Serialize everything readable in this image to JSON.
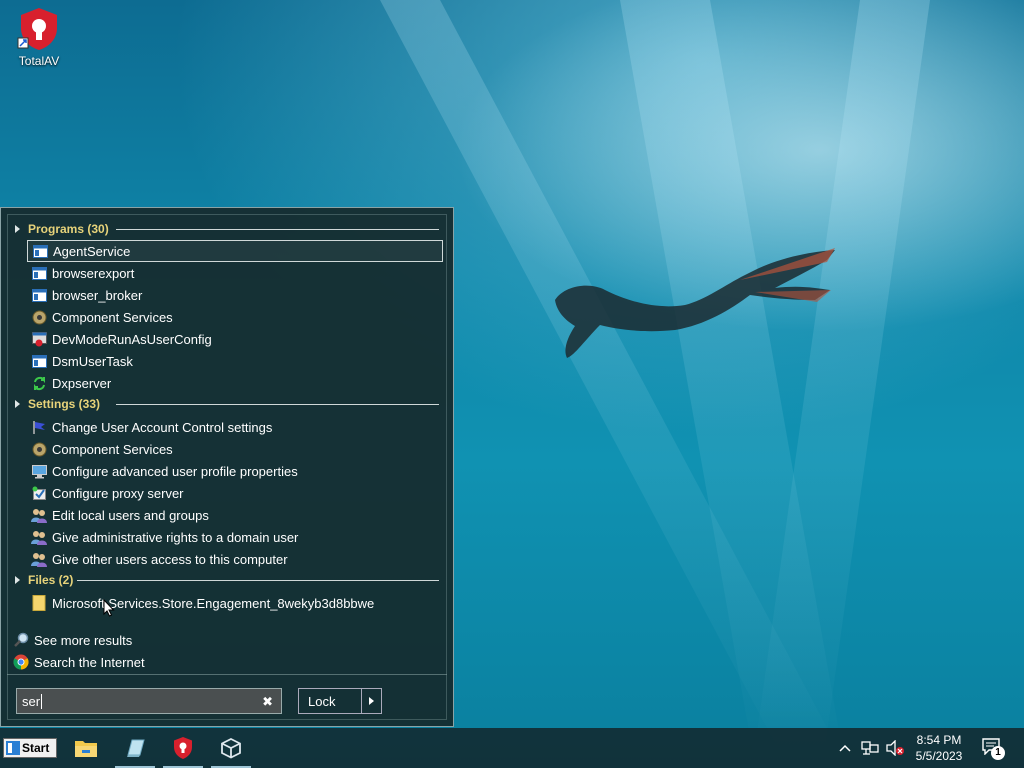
{
  "desktop": {
    "icons": [
      {
        "label": "TotalAV",
        "icon": "totalav-shield-icon"
      }
    ]
  },
  "start_menu": {
    "groups": [
      {
        "title": "Programs (30)",
        "items": [
          {
            "label": "AgentService",
            "icon": "app-window-icon",
            "selected": true
          },
          {
            "label": "browserexport",
            "icon": "app-window-icon"
          },
          {
            "label": "browser_broker",
            "icon": "app-window-icon"
          },
          {
            "label": "Component Services",
            "icon": "component-services-icon"
          },
          {
            "label": "DevModeRunAsUserConfig",
            "icon": "devmode-icon"
          },
          {
            "label": "DsmUserTask",
            "icon": "app-window-icon"
          },
          {
            "label": "Dxpserver",
            "icon": "sync-arrows-icon"
          }
        ]
      },
      {
        "title": "Settings (33)",
        "items": [
          {
            "label": "Change User Account Control settings",
            "icon": "uac-flag-icon"
          },
          {
            "label": "Component Services",
            "icon": "component-services-icon"
          },
          {
            "label": "Configure advanced user profile properties",
            "icon": "monitor-icon"
          },
          {
            "label": "Configure proxy server",
            "icon": "proxy-check-icon"
          },
          {
            "label": "Edit local users and groups",
            "icon": "users-icon"
          },
          {
            "label": "Give administrative rights to a domain user",
            "icon": "users-icon"
          },
          {
            "label": "Give other users access to this computer",
            "icon": "users-icon"
          }
        ]
      },
      {
        "title": "Files (2)",
        "items": [
          {
            "label": "Microsoft.Services.Store.Engagement_8wekyb3d8bbwe",
            "icon": "folder-icon"
          }
        ]
      }
    ],
    "extras": [
      {
        "label": "See more results",
        "icon": "magnifier-icon"
      },
      {
        "label": "Search the Internet",
        "icon": "chrome-icon"
      }
    ],
    "search": {
      "value": "ser"
    },
    "power_button": {
      "label": "Lock"
    }
  },
  "taskbar": {
    "start_label": "Start",
    "apps": [
      {
        "name": "file-explorer-icon"
      },
      {
        "name": "notepad-app-icon"
      },
      {
        "name": "totalav-taskbar-icon"
      },
      {
        "name": "virtualbox-cube-icon"
      }
    ],
    "clock": {
      "time": "8:54 PM",
      "date": "5/5/2023"
    },
    "notifications_count": "1",
    "colors": {
      "accent": "#e7d37a",
      "totalav_red": "#d8202d"
    }
  }
}
